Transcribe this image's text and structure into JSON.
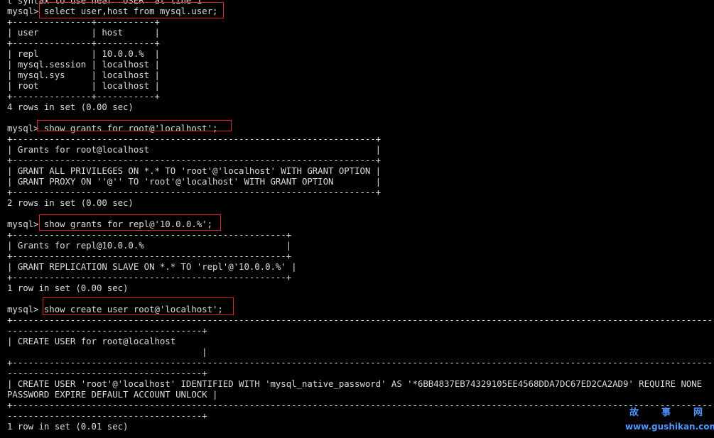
{
  "terminal": {
    "lines": [
      "t syntax to use near 'USER' at line 1",
      "mysql> select user,host from mysql.user;",
      "+---------------+-----------+",
      "| user          | host      |",
      "+---------------+-----------+",
      "| repl          | 10.0.0.%  |",
      "| mysql.session | localhost |",
      "| mysql.sys     | localhost |",
      "| root          | localhost |",
      "+---------------+-----------+",
      "4 rows in set (0.00 sec)",
      "",
      "mysql> show grants for root@'localhost';",
      "+---------------------------------------------------------------------+",
      "| Grants for root@localhost                                           |",
      "+---------------------------------------------------------------------+",
      "| GRANT ALL PRIVILEGES ON *.* TO 'root'@'localhost' WITH GRANT OPTION |",
      "| GRANT PROXY ON ''@'' TO 'root'@'localhost' WITH GRANT OPTION        |",
      "+---------------------------------------------------------------------+",
      "2 rows in set (0.00 sec)",
      "",
      "mysql> show grants for repl@'10.0.0.%';",
      "+----------------------------------------------------+",
      "| Grants for repl@10.0.0.%                           |",
      "+----------------------------------------------------+",
      "| GRANT REPLICATION SLAVE ON *.* TO 'repl'@'10.0.0.%' |",
      "+----------------------------------------------------+",
      "1 row in set (0.00 sec)",
      "",
      "mysql> show create user root@'localhost';",
      "+-------------------------------------------------------------------------------------------------------------------------------------",
      "-------------------------------------+",
      "| CREATE USER for root@localhost",
      "                                     |",
      "+-------------------------------------------------------------------------------------------------------------------------------------",
      "-------------------------------------+",
      "| CREATE USER 'root'@'localhost' IDENTIFIED WITH 'mysql_native_password' AS '*6BB4837EB74329105EE4568DDA7DC67ED2CA2AD9' REQUIRE NONE",
      "PASSWORD EXPIRE DEFAULT ACCOUNT UNLOCK |",
      "+-------------------------------------------------------------------------------------------------------------------------------------",
      "-------------------------------------+",
      "1 row in set (0.01 sec)"
    ]
  },
  "highlight_color": "#e0262a",
  "watermark": {
    "chars": [
      "故",
      "事",
      "网"
    ],
    "url": "www.gushikan.com",
    "color": "#4f96ff"
  }
}
